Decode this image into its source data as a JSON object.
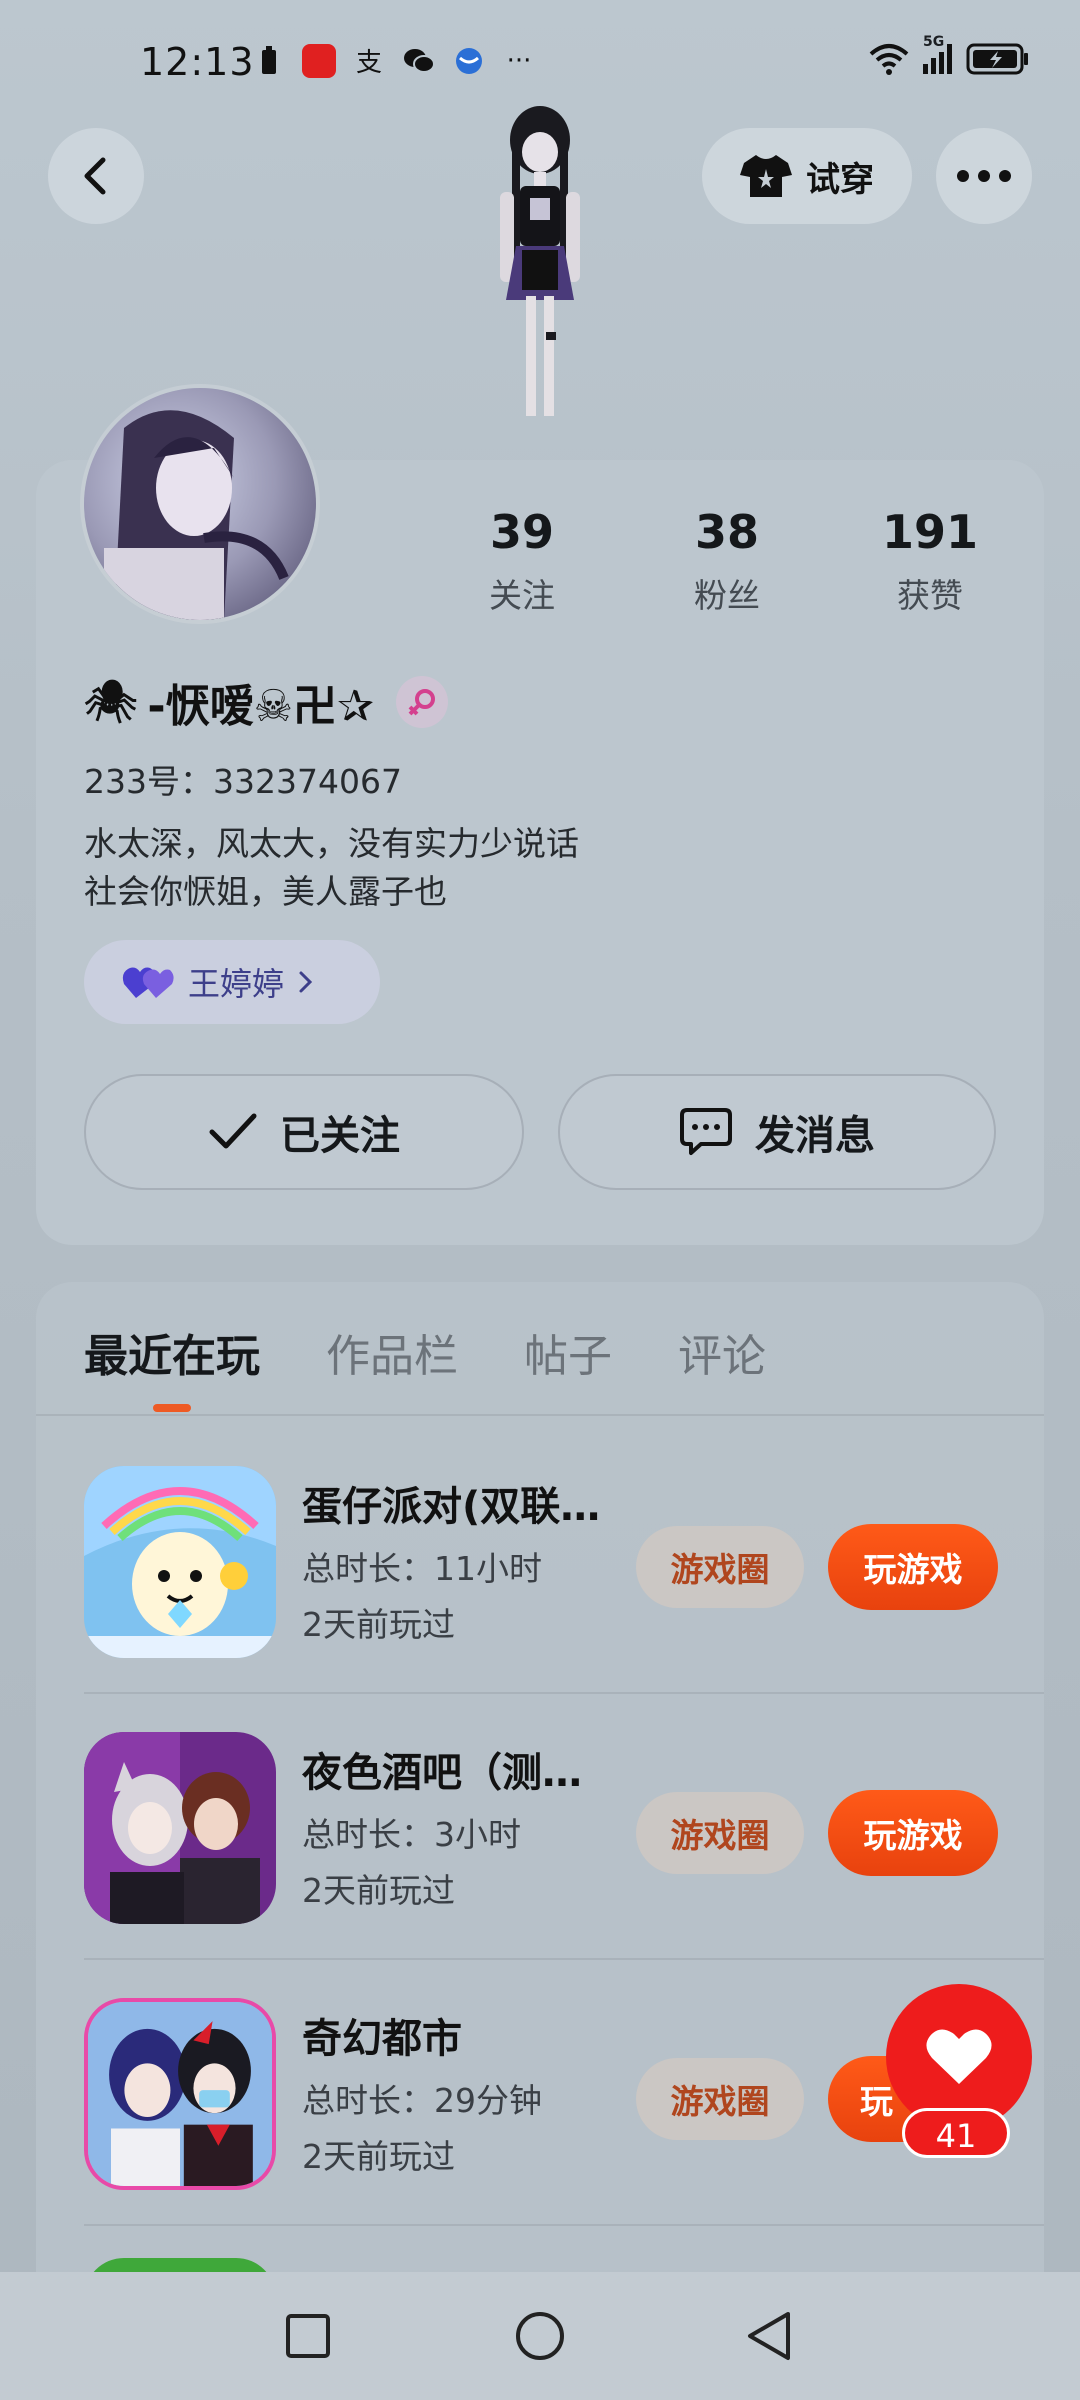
{
  "status_bar": {
    "time": "12:13",
    "network": "5G",
    "more": "···"
  },
  "header": {
    "try_on_label": "试穿"
  },
  "profile": {
    "stats": [
      {
        "value": "39",
        "label": "关注"
      },
      {
        "value": "38",
        "label": "粉丝"
      },
      {
        "value": "191",
        "label": "获赞"
      }
    ],
    "nickname": "-恹嗳☠卍✰",
    "nickname_emoji": "🕷",
    "id_line": "233号：332374067",
    "bio_line1": "水太深，风太大，没有实力少说话",
    "bio_line2": "社会你恹姐，美人露子也",
    "cp_name": "王婷婷",
    "follow_label": "已关注",
    "message_label": "发消息"
  },
  "tabs": [
    {
      "label": "最近在玩",
      "active": true
    },
    {
      "label": "作品栏",
      "active": false
    },
    {
      "label": "帖子",
      "active": false
    },
    {
      "label": "评论",
      "active": false
    }
  ],
  "games": [
    {
      "name": "蛋仔派对(双联…",
      "duration": "总时长：11小时",
      "last_played": "2天前玩过",
      "circle_label": "游戏圈",
      "play_label": "玩游戏"
    },
    {
      "name": "夜色酒吧（测…",
      "duration": "总时长：3小时",
      "last_played": "2天前玩过",
      "circle_label": "游戏圈",
      "play_label": "玩游戏"
    },
    {
      "name": "奇幻都市",
      "duration": "总时长：29分钟",
      "last_played": "2天前玩过",
      "circle_label": "游戏圈",
      "play_label": "玩"
    }
  ],
  "like_fab": {
    "count": "41"
  },
  "colors": {
    "accent": "#ee5a24",
    "play_button": "#ff5a18",
    "like": "#ee1c1c",
    "cp_text": "#3d3f8a"
  }
}
